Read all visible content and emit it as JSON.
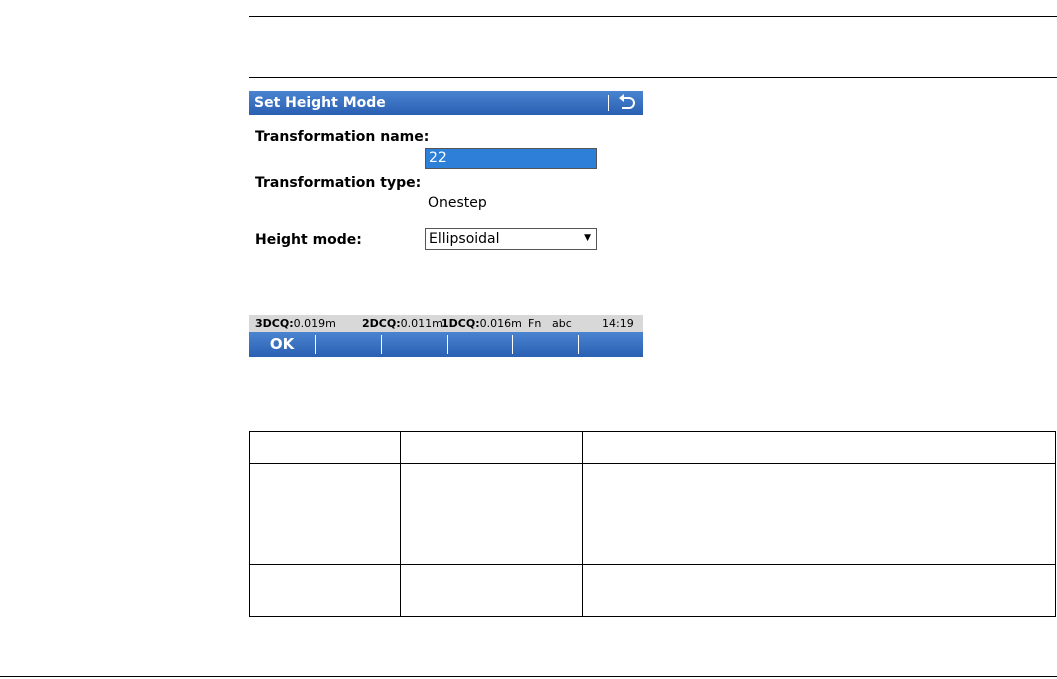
{
  "screen": {
    "title": "Set Height Mode",
    "back_icon": "back-arrow-icon",
    "fields": {
      "transformation_name_label": "Transformation name:",
      "transformation_name_value": "22",
      "transformation_type_label": "Transformation type:",
      "transformation_type_value": "Onestep",
      "height_mode_label": "Height mode:",
      "height_mode_value": "Ellipsoidal"
    },
    "status": {
      "q3_label": "3DCQ:",
      "q3_value": "0.019m",
      "q2_label": "2DCQ:",
      "q2_value": "0.011m",
      "q1_label": "1DCQ:",
      "q1_value": "0.016m",
      "fn": "Fn",
      "input_mode": "abc",
      "time": "14:19"
    },
    "softkeys": [
      "OK",
      "",
      "",
      "",
      "",
      ""
    ],
    "colors": {
      "titlebar": "#2a5fb2",
      "selection": "#2d7fd8",
      "statusbar": "#d8d8d8"
    }
  },
  "table": {
    "headers": [
      "",
      "",
      ""
    ],
    "rows": [
      [
        "",
        "",
        ""
      ],
      [
        "",
        "",
        ""
      ]
    ]
  }
}
